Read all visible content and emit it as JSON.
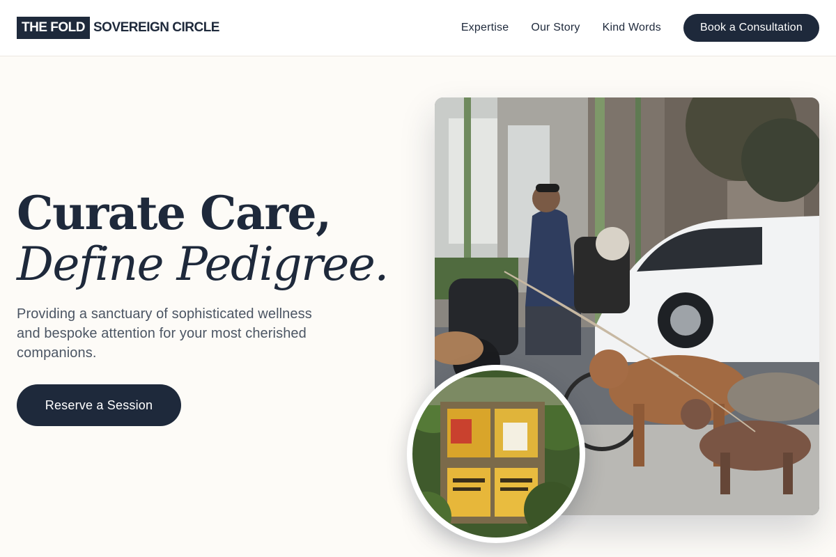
{
  "brand": {
    "box_text": "THE FOLD",
    "name": "SOVEREIGN CIRCLE"
  },
  "nav": {
    "links": [
      "Expertise",
      "Our Story",
      "Kind Words"
    ],
    "cta": "Book a Consultation"
  },
  "hero": {
    "title_line1": "Curate Care,",
    "title_line2": "Define Pedigree.",
    "description": "Providing a sanctuary of sophisticated wellness and bespoke attention for your most cherished companions.",
    "button": "Reserve a Session"
  },
  "colors": {
    "accent": "#1e293b",
    "background": "#fdfbf7",
    "text_muted": "#4b5563"
  }
}
